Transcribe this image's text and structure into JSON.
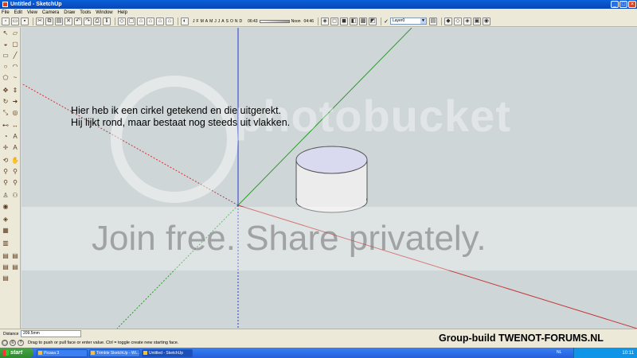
{
  "window": {
    "title": "Untitled - SketchUp",
    "controls": [
      "_",
      "□",
      "×"
    ]
  },
  "menu": [
    "File",
    "Edit",
    "View",
    "Camera",
    "Draw",
    "Tools",
    "Window",
    "Help"
  ],
  "toolbar": {
    "months": [
      "J",
      "F",
      "M",
      "A",
      "M",
      "J",
      "J",
      "A",
      "S",
      "O",
      "N",
      "D"
    ],
    "time_start": "06:43",
    "time_noon": "Noon",
    "time_end": "04:46",
    "layer_checked": "✓",
    "layer_name": "Layer0"
  },
  "viewport": {
    "annotation_line1": "Hier heb ik een cirkel getekend en die uitgerekt.",
    "annotation_line2": "Hij lijkt rond, maar bestaat nog steeds uit vlakken."
  },
  "watermark": {
    "brand": "photobucket",
    "join": "Join free. Share privately."
  },
  "measurements": {
    "label": "Distance",
    "value": "209.5mm"
  },
  "status": {
    "hint": "Drag to push or pull face or enter value.  Ctrl = toggle create new starting face.",
    "overlay": "Group-build TWENOT-FORUMS.NL"
  },
  "taskbar": {
    "start": "start",
    "tasks": [
      "Picasa 3",
      "Trimble SketchUp - Wi...",
      "Untitled - SketchUp"
    ],
    "lang": "NL",
    "clock": "10:11"
  },
  "colors": {
    "axis_red": "#c2383b",
    "axis_green": "#2a9a2a",
    "axis_blue": "#2a3acf",
    "viewport_bg": "#cfd6d8",
    "cylinder_top": "#d9d9f0",
    "cylinder_side": "#ececec"
  }
}
